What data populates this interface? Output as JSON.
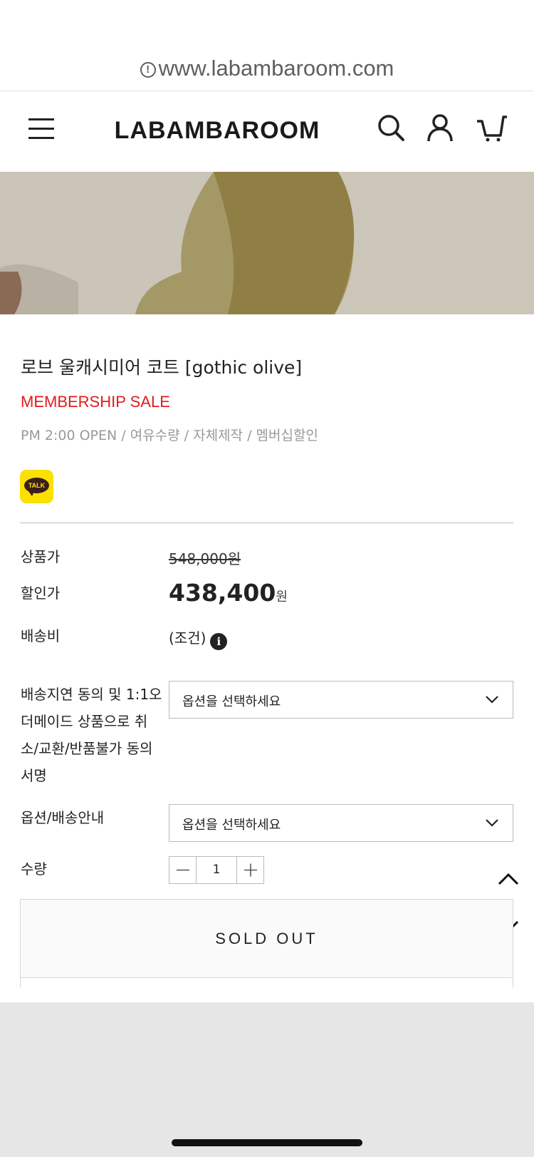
{
  "browser": {
    "url": "www.labambaroom.com"
  },
  "header": {
    "brand": "LABAMBAROOM",
    "icons": [
      "menu-icon",
      "search-icon",
      "user-icon",
      "cart-icon"
    ]
  },
  "product": {
    "title": "로브 울캐시미어 코트 [gothic olive]",
    "sale_badge": "MEMBERSHIP SALE",
    "description": "PM 2:00 OPEN / 여유수량 / 자체제작 / 멤버십할인",
    "talk_label": "TALK"
  },
  "price": {
    "list_label": "상품가",
    "list_value": "548,000원",
    "sale_label": "할인가",
    "sale_value": "438,400",
    "sale_unit": "원",
    "shipping_label": "배송비",
    "shipping_value": "(조건)"
  },
  "options": [
    {
      "label": "배송지연 동의 및 1:1오더메이드 상품으로 취소/교환/반품불가 동의서명",
      "selected": "옵션을 선택하세요"
    },
    {
      "label": "옵션/배송안내",
      "selected": "옵션을 선택하세요"
    }
  ],
  "quantity": {
    "label": "수량",
    "value": "1"
  },
  "buy": {
    "sold_out_label": "SOLD OUT"
  },
  "colors": {
    "sale_red": "#e31b1b",
    "talk_yellow": "#fae100"
  }
}
